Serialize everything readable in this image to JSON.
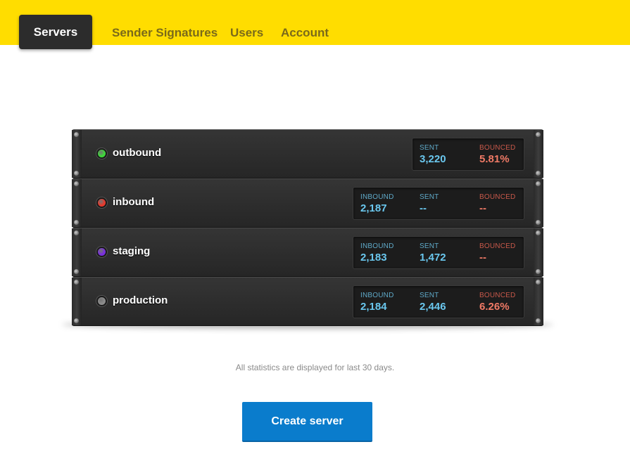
{
  "nav": {
    "tabs": [
      {
        "label": "Servers"
      },
      {
        "label": "Sender Signatures"
      },
      {
        "label": "Users"
      },
      {
        "label": "Account"
      }
    ]
  },
  "colors": {
    "topbar": "#ffdd00",
    "active_tab": "#2c2c2c",
    "stat_blue": "#6ac7ee",
    "stat_red": "#f07a66",
    "button": "#0a7ccc"
  },
  "servers": [
    {
      "name": "outbound",
      "status_color": "#3ed93a",
      "stats": [
        {
          "label": "SENT",
          "value": "3,220",
          "tone": "blue"
        },
        {
          "label": "BOUNCED",
          "value": "5.81%",
          "tone": "red"
        }
      ]
    },
    {
      "name": "inbound",
      "status_color": "#e8392c",
      "stats": [
        {
          "label": "INBOUND",
          "value": "2,187",
          "tone": "blue"
        },
        {
          "label": "SENT",
          "value": "--",
          "tone": "blue"
        },
        {
          "label": "BOUNCED",
          "value": "--",
          "tone": "red"
        }
      ]
    },
    {
      "name": "staging",
      "status_color": "#7a2ee0",
      "stats": [
        {
          "label": "INBOUND",
          "value": "2,183",
          "tone": "blue"
        },
        {
          "label": "SENT",
          "value": "1,472",
          "tone": "blue"
        },
        {
          "label": "BOUNCED",
          "value": "--",
          "tone": "red"
        }
      ]
    },
    {
      "name": "production",
      "status_color": "#8c8c8c",
      "stats": [
        {
          "label": "INBOUND",
          "value": "2,184",
          "tone": "blue"
        },
        {
          "label": "SENT",
          "value": "2,446",
          "tone": "blue"
        },
        {
          "label": "BOUNCED",
          "value": "6.26%",
          "tone": "red"
        }
      ]
    }
  ],
  "footnote": "All statistics are displayed for last 30 days.",
  "create_button": "Create server"
}
